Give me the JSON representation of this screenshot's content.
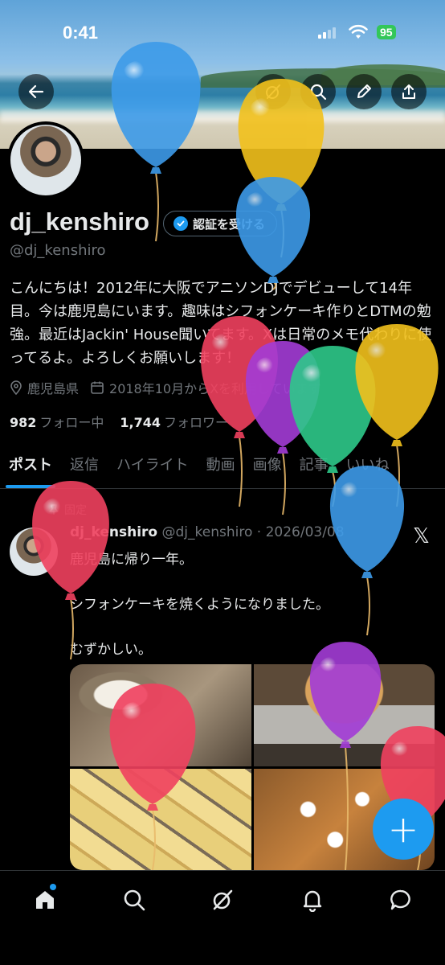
{
  "status_bar": {
    "time": "0:41",
    "battery": "95"
  },
  "header_actions": [
    "back-icon",
    "grok-icon",
    "search-icon",
    "edit-icon",
    "share-icon"
  ],
  "profile": {
    "name": "dj_kenshiro",
    "handle": "@dj_kenshiro",
    "verify_button": "認証を受ける",
    "bio": "こんにちは！2012年に大阪でアニソンDJでデビューして14年目。今は鹿児島にいます。趣味はシフォンケーキ作りとDTMの勉強。最近はJackin' House聞いてます。Xは日常のメモ代わりに使ってるよ。よろしくお願いします！",
    "location": "鹿児島県",
    "joined": "2018年10月からXを利用しています",
    "following_count": "982",
    "following_label": "フォロー中",
    "followers_count": "1,744",
    "followers_label": "フォロワー"
  },
  "tabs": [
    "ポスト",
    "返信",
    "ハイライト",
    "動画",
    "画像",
    "記事",
    "いいね"
  ],
  "pinned_post": {
    "pinned_label": "固定",
    "author_name": "dj_kenshiro",
    "author_handle": "@dj_kenshiro",
    "date": "· 2026/03/08",
    "text": "鹿児島に帰り一年。\n\nシフォンケーキを焼くようになりました。\n\nむずかしい。",
    "media_count": 4
  },
  "fab_label": "+",
  "bottom_nav": [
    "home-icon",
    "search-icon",
    "grok-icon",
    "notifications-icon",
    "messages-icon"
  ],
  "colors": {
    "accent": "#1d9bf0",
    "background": "#000000",
    "secondary_text": "#71767b",
    "balloon_blue": "#3d9be9",
    "balloon_yellow": "#f2c11c",
    "balloon_red": "#f0415f",
    "balloon_purple": "#a33cd6",
    "balloon_green": "#2ec98a"
  }
}
